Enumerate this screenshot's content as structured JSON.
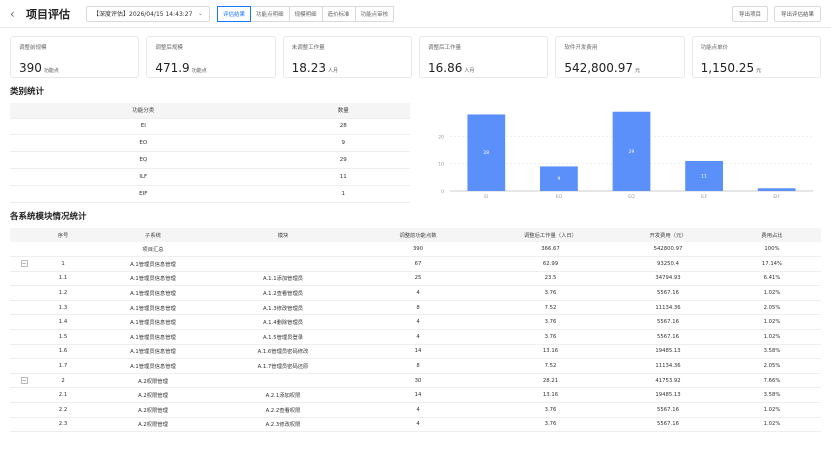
{
  "header": {
    "title": "项目评估",
    "project_select": "【深度评估】2026/04/15 14:43:27",
    "tabs": [
      "评估结果",
      "功能点明细",
      "规模明细",
      "造价标准",
      "功能点审核"
    ],
    "export_project": "导出项目",
    "export_result": "导出评估结果"
  },
  "cards": [
    {
      "label": "调整前规模",
      "value": "390",
      "unit": "功能点"
    },
    {
      "label": "调整后规模",
      "value": "471.9",
      "unit": "功能点"
    },
    {
      "label": "未调整工作量",
      "value": "18.23",
      "unit": "人月"
    },
    {
      "label": "调整后工作量",
      "value": "16.86",
      "unit": "人月"
    },
    {
      "label": "软件开发费用",
      "value": "542,800.97",
      "unit": "元"
    },
    {
      "label": "功能点单价",
      "value": "1,150.25",
      "unit": "元"
    }
  ],
  "category": {
    "title": "类别统计",
    "headers": [
      "功能分类",
      "数量"
    ],
    "rows": [
      [
        "EI",
        "28"
      ],
      [
        "EO",
        "9"
      ],
      [
        "EQ",
        "29"
      ],
      [
        "ILF",
        "11"
      ],
      [
        "EIF",
        "1"
      ]
    ]
  },
  "chart_data": {
    "type": "bar",
    "categories": [
      "EI",
      "EO",
      "EQ",
      "ILF",
      "EIF"
    ],
    "values": [
      28,
      9,
      29,
      11,
      1
    ],
    "ylim": [
      0,
      30
    ],
    "yticks": [
      "0",
      "10",
      "20"
    ],
    "color": "#5b8ff9"
  },
  "modules": {
    "title": "各系统模块情况统计",
    "headers": [
      "序号",
      "子系统",
      "模块",
      "调整前功能点数",
      "调整后工作量（人日）",
      "开发费用（元）",
      "费用占比"
    ],
    "rows": [
      {
        "toggle": "",
        "no": "",
        "sub": "项目汇总",
        "mod": "",
        "fp": "390",
        "work": "366.67",
        "cost": "542800.97",
        "ratio": "100%"
      },
      {
        "toggle": "−",
        "no": "1",
        "sub": "A.1管理员信息管理",
        "mod": "",
        "fp": "67",
        "work": "62.99",
        "cost": "93250.4",
        "ratio": "17.14%"
      },
      {
        "toggle": "",
        "no": "1.1",
        "sub": "A.1管理员信息管理",
        "mod": "A.1.1添加管理员",
        "fp": "25",
        "work": "23.5",
        "cost": "34794.93",
        "ratio": "6.41%"
      },
      {
        "toggle": "",
        "no": "1.2",
        "sub": "A.1管理员信息管理",
        "mod": "A.1.2查看管理员",
        "fp": "4",
        "work": "3.76",
        "cost": "5567.16",
        "ratio": "1.02%"
      },
      {
        "toggle": "",
        "no": "1.3",
        "sub": "A.1管理员信息管理",
        "mod": "A.1.3修改管理员",
        "fp": "8",
        "work": "7.52",
        "cost": "11134.36",
        "ratio": "2.05%"
      },
      {
        "toggle": "",
        "no": "1.4",
        "sub": "A.1管理员信息管理",
        "mod": "A.1.4删除管理员",
        "fp": "4",
        "work": "3.76",
        "cost": "5567.16",
        "ratio": "1.02%"
      },
      {
        "toggle": "",
        "no": "1.5",
        "sub": "A.1管理员信息管理",
        "mod": "A.1.5管理员登录",
        "fp": "4",
        "work": "3.76",
        "cost": "5567.16",
        "ratio": "1.02%"
      },
      {
        "toggle": "",
        "no": "1.6",
        "sub": "A.1管理员信息管理",
        "mod": "A.1.6管理员密码修改",
        "fp": "14",
        "work": "13.16",
        "cost": "19485.13",
        "ratio": "3.58%"
      },
      {
        "toggle": "",
        "no": "1.7",
        "sub": "A.1管理员信息管理",
        "mod": "A.1.7管理员密码还原",
        "fp": "8",
        "work": "7.52",
        "cost": "11134.36",
        "ratio": "2.05%"
      },
      {
        "toggle": "−",
        "no": "2",
        "sub": "A.2权限管理",
        "mod": "",
        "fp": "30",
        "work": "28.21",
        "cost": "41753.92",
        "ratio": "7.66%"
      },
      {
        "toggle": "",
        "no": "2.1",
        "sub": "A.2权限管理",
        "mod": "A.2.1添加权限",
        "fp": "14",
        "work": "13.16",
        "cost": "19485.13",
        "ratio": "3.58%"
      },
      {
        "toggle": "",
        "no": "2.2",
        "sub": "A.2权限管理",
        "mod": "A.2.2查看权限",
        "fp": "4",
        "work": "3.76",
        "cost": "5567.16",
        "ratio": "1.02%"
      },
      {
        "toggle": "",
        "no": "2.3",
        "sub": "A.2权限管理",
        "mod": "A.2.3修改权限",
        "fp": "4",
        "work": "3.76",
        "cost": "5567.16",
        "ratio": "1.02%"
      }
    ]
  }
}
